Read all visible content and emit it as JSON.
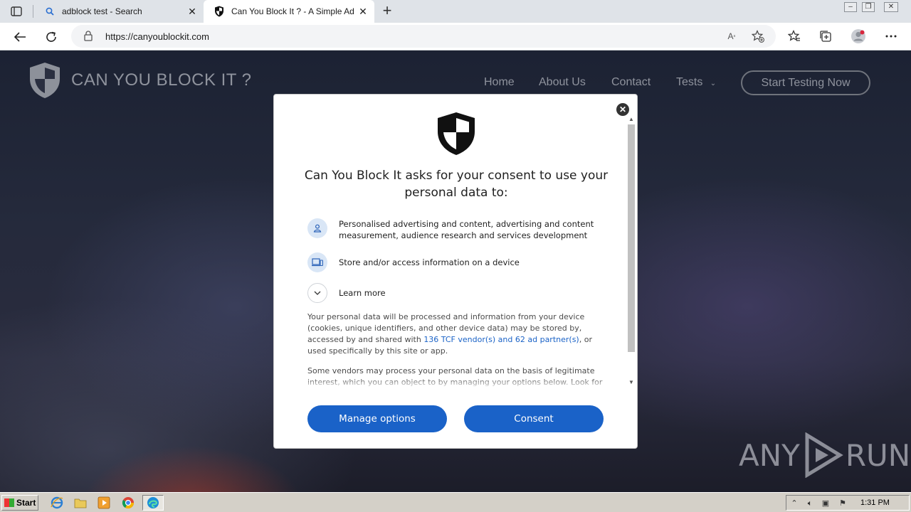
{
  "browser": {
    "tabs": [
      {
        "title": "adblock test - Search",
        "icon": "search-icon"
      },
      {
        "title": "Can You Block It ? - A Simple Ad Block Tester",
        "icon": "shield-icon"
      }
    ],
    "url": "https://canyoublockit.com",
    "window_controls": [
      "minimize",
      "restore",
      "close"
    ]
  },
  "site": {
    "brand": "CAN YOU BLOCK IT ?",
    "nav": [
      {
        "label": "Home"
      },
      {
        "label": "About Us"
      },
      {
        "label": "Contact"
      },
      {
        "label": "Tests"
      }
    ],
    "cta_label": "Start Testing Now"
  },
  "consent": {
    "title": "Can You Block It asks for your consent to use your personal data to:",
    "purposes": [
      {
        "text": "Personalised advertising and content, advertising and content measurement, audience research and services development",
        "icon": "person-icon"
      },
      {
        "text": "Store and/or access information on a device",
        "icon": "device-icon"
      }
    ],
    "learn_more": "Learn more",
    "body1_pre": "Your personal data will be processed and information from your device (cookies, unique identifiers, and other device data) may be stored by, accessed by and shared with ",
    "body1_link": "136 TCF vendor(s) and 62 ad partner(s)",
    "body1_post": ", or used specifically by this site or app.",
    "body2": "Some vendors may process your personal data on the basis of legitimate interest, which you can object to by managing your options below. Look for",
    "manage_label": "Manage options",
    "consent_label": "Consent"
  },
  "watermark": {
    "left": "ANY",
    "right": "RUN"
  },
  "taskbar": {
    "start_label": "Start",
    "clock": "1:31 PM"
  },
  "colors": {
    "accent": "#1a62c8",
    "page_bg": "#1c2233"
  }
}
